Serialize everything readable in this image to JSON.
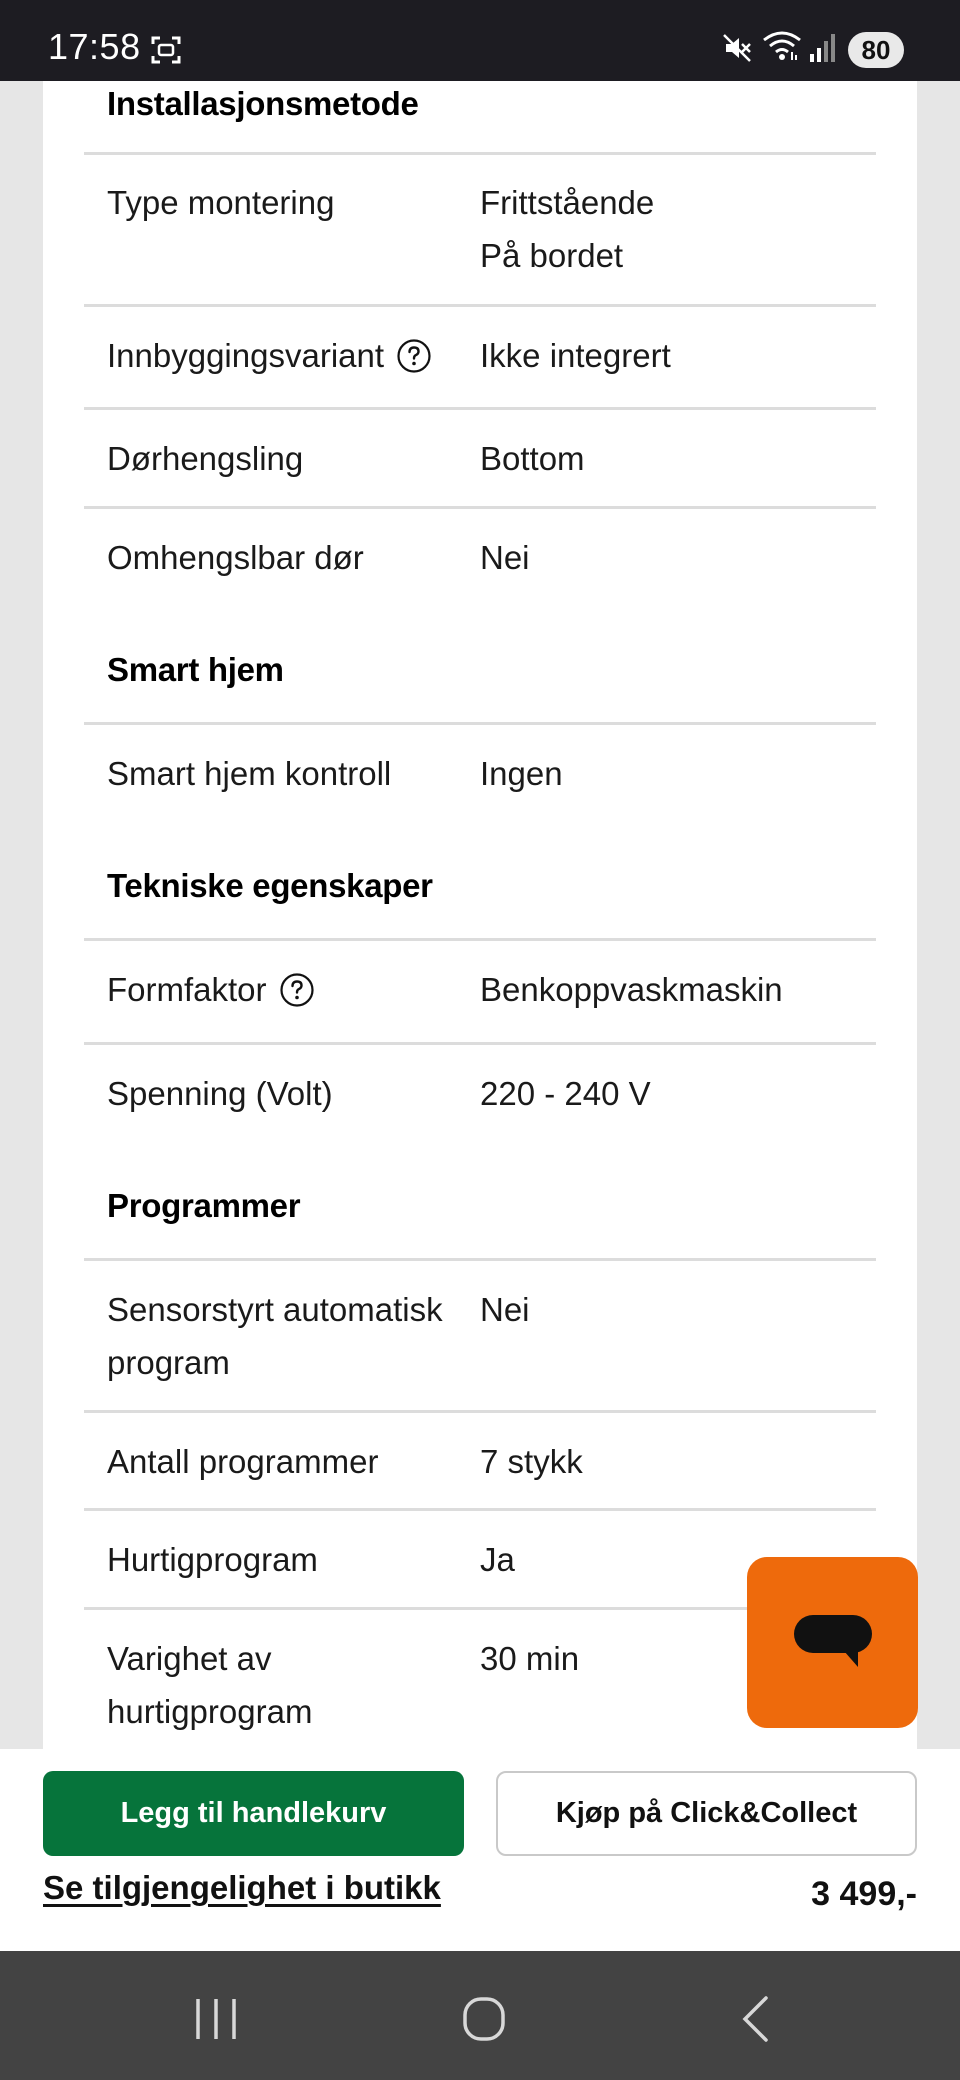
{
  "status_bar": {
    "time": "17:58",
    "battery": "80",
    "icons": [
      "screenshot-icon",
      "mute-icon",
      "wifi-icon",
      "signal-icon"
    ]
  },
  "specs": {
    "installation": {
      "heading": "Installasjonsmetode",
      "rows": [
        {
          "label": "Type montering",
          "value_line1": "Frittstående",
          "value_line2": "På bordet"
        },
        {
          "label": "Innbyggingsvariant",
          "value": "Ikke integrert",
          "help": true
        },
        {
          "label": "Dørhengsling",
          "value": "Bottom"
        },
        {
          "label": "Omhengslbar dør",
          "value": "Nei"
        }
      ]
    },
    "smart_home": {
      "heading": "Smart hjem",
      "rows": [
        {
          "label": "Smart hjem kontroll",
          "value": "Ingen"
        }
      ]
    },
    "technical": {
      "heading": "Tekniske egenskaper",
      "rows": [
        {
          "label": "Formfaktor",
          "value": "Benkoppvaskmaskin",
          "help": true
        },
        {
          "label": "Spenning (Volt)",
          "value": "220 - 240 V"
        }
      ]
    },
    "programs": {
      "heading": "Programmer",
      "rows": [
        {
          "label_line1": "Sensorstyrt automatisk",
          "label_line2": "program",
          "value": "Nei"
        },
        {
          "label": "Antall programmer",
          "value": "7 stykk"
        },
        {
          "label": "Hurtigprogram",
          "value": "Ja"
        },
        {
          "label_line1": "Varighet av",
          "label_line2": "hurtigprogram",
          "value": "30 min"
        }
      ]
    }
  },
  "purchase": {
    "cart_label": "Legg til handlekurv",
    "collect_label": "Kjøp på Click&Collect",
    "availability_label": "Se tilgjengelighet i butikk",
    "price": "3 499,-"
  },
  "colors": {
    "primary_green": "#06743b",
    "chat_orange": "#ee6a0c",
    "status_bar_bg": "#1d1c22",
    "nav_bar_bg": "#434343"
  }
}
